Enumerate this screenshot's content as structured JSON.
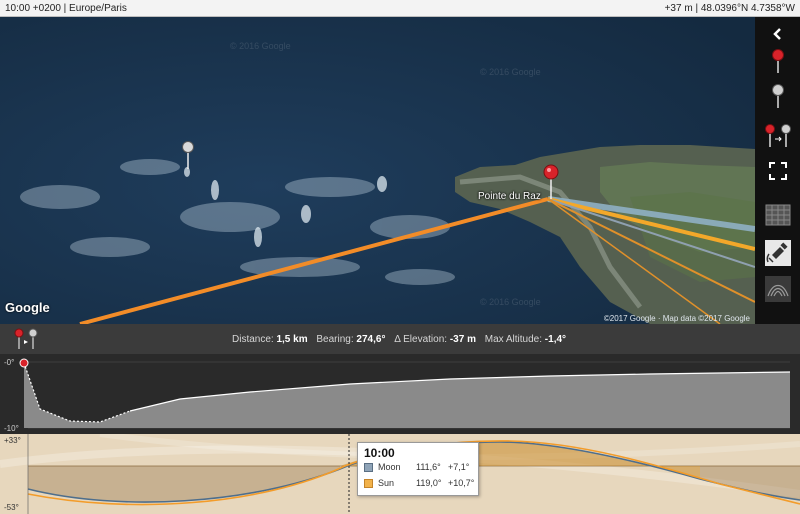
{
  "topbar": {
    "time_zone": "10:00 +0200 | Europe/Paris",
    "location": "+37 m | 48.0396°N 4.7358°W"
  },
  "map": {
    "place_label": "Pointe du Raz",
    "logo": "Google",
    "copyright": "©2017 Google · Map data ©2017 Google",
    "watermark": "© 2016 Google",
    "sun_line_color": "#f39c2a",
    "moon_line_color": "#8fb0c4"
  },
  "sidebar": {
    "buttons": [
      {
        "name": "back-icon"
      },
      {
        "name": "red-pin-icon"
      },
      {
        "name": "grey-pin-icon"
      },
      {
        "name": "swap-pins-icon"
      },
      {
        "name": "fullscreen-icon"
      },
      {
        "name": "map-type-icon"
      },
      {
        "name": "satellite-icon"
      },
      {
        "name": "terrain-icon"
      }
    ]
  },
  "info": {
    "distance_label": "Distance:",
    "distance_value": "1,5 km",
    "bearing_label": "Bearing:",
    "bearing_value": "274,6°",
    "elevation_label": "Δ Elevation:",
    "elevation_value": "-37 m",
    "max_altitude_label": "Max Altitude:",
    "max_altitude_value": "-1,4°"
  },
  "elevation_profile": {
    "axis_top": "-0°",
    "axis_bottom": "-10°"
  },
  "sun_moon": {
    "axis_top": "+33°",
    "axis_bottom": "-53°",
    "tooltip": {
      "time": "10:00",
      "moon": {
        "label": "Moon",
        "azimuth": "111,6°",
        "altitude": "+7,1°",
        "color": "#8fa4b8"
      },
      "sun": {
        "label": "Sun",
        "azimuth": "119,0°",
        "altitude": "+10,7°",
        "color": "#f2b24a"
      }
    }
  }
}
